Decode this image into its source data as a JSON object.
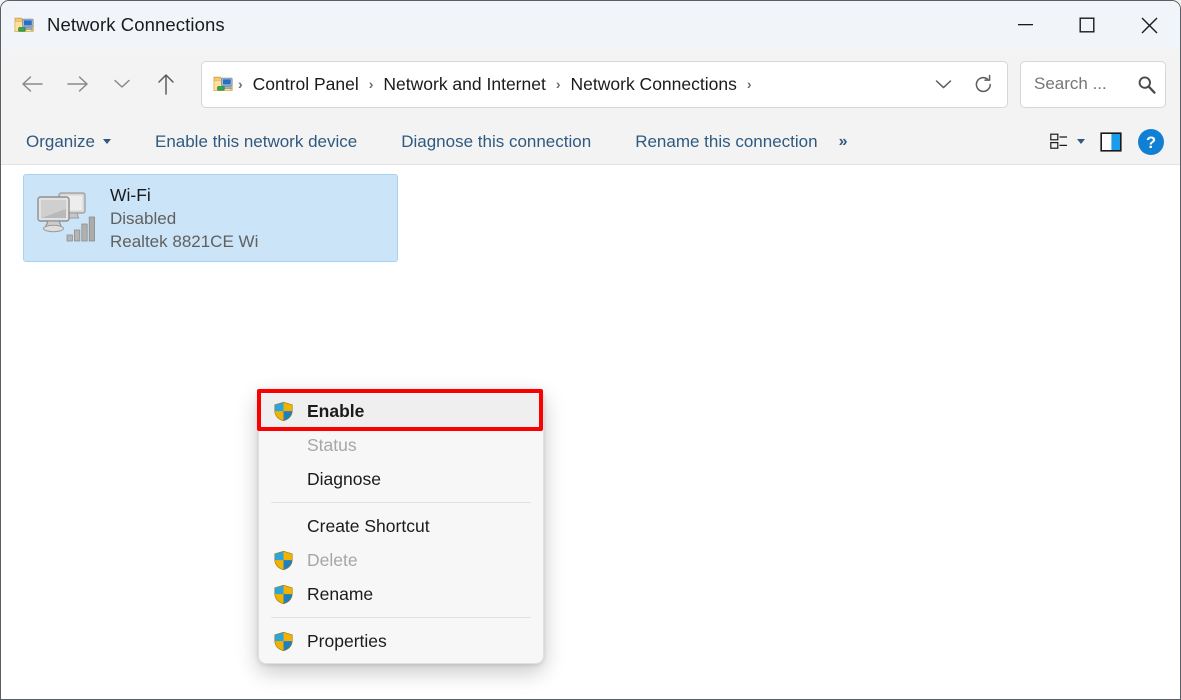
{
  "window": {
    "title": "Network Connections",
    "icon": "network-connections-folder-icon",
    "minimize_label": "Minimize",
    "maximize_label": "Maximize",
    "close_label": "Close"
  },
  "nav": {
    "back_label": "Back",
    "forward_label": "Forward",
    "recent_label": "Recent locations",
    "up_label": "Up",
    "refresh_label": "Refresh",
    "history_label": "Previous locations"
  },
  "breadcrumb": {
    "icon": "network-connections-folder-icon",
    "items": [
      {
        "label": "Control Panel"
      },
      {
        "label": "Network and Internet"
      },
      {
        "label": "Network Connections"
      }
    ],
    "separator": "›"
  },
  "search": {
    "placeholder": "Search ...",
    "value": "",
    "icon": "search-icon"
  },
  "toolbar": {
    "organize_label": "Organize",
    "enable_label": "Enable this network device",
    "diagnose_label": "Diagnose this connection",
    "rename_label": "Rename this connection",
    "overflow_label": "»",
    "view_label": "Change your view",
    "preview_label": "Show the preview pane",
    "help_label": "?"
  },
  "connections": [
    {
      "name": "Wi-Fi",
      "status": "Disabled",
      "device": "Realtek 8821CE Wi",
      "icon": "disabled-wireless-adapter-icon",
      "selected": true
    }
  ],
  "context_menu": {
    "items": [
      {
        "label": "Enable",
        "shield": true,
        "disabled": false,
        "bold": true,
        "highlighted": true
      },
      {
        "label": "Status",
        "shield": false,
        "disabled": true,
        "bold": false,
        "highlighted": false
      },
      {
        "label": "Diagnose",
        "shield": false,
        "disabled": false,
        "bold": false,
        "highlighted": false
      },
      {
        "separator": true
      },
      {
        "label": "Create Shortcut",
        "shield": false,
        "disabled": false,
        "bold": false,
        "highlighted": false
      },
      {
        "label": "Delete",
        "shield": true,
        "disabled": true,
        "bold": false,
        "highlighted": false
      },
      {
        "label": "Rename",
        "shield": true,
        "disabled": false,
        "bold": false,
        "highlighted": false
      },
      {
        "separator": true
      },
      {
        "label": "Properties",
        "shield": true,
        "disabled": false,
        "bold": false,
        "highlighted": false
      }
    ]
  },
  "colors": {
    "highlight_red": "#fb0000",
    "selection_blue": "#cce4f7",
    "toolbar_link": "#2f5a80",
    "accent_blue": "#0a84d8",
    "titlebar_bg": "#f1f4f8",
    "chrome_bg": "#f3f3f3"
  }
}
